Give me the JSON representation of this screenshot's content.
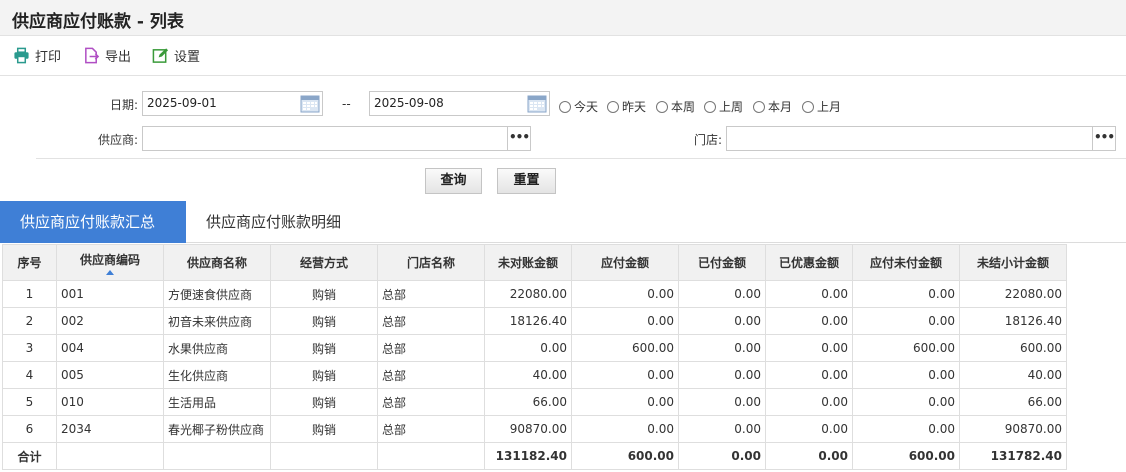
{
  "page": {
    "title": "供应商应付账款 - 列表"
  },
  "toolbar": {
    "print_label": "打印",
    "export_label": "导出",
    "settings_label": "设置"
  },
  "filter": {
    "date_label": "日期:",
    "date_from": "2025-09-01",
    "date_sep": "--",
    "date_to": "2025-09-08",
    "quick_dates": [
      "今天",
      "昨天",
      "本周",
      "上周",
      "本月",
      "上月"
    ],
    "supplier_label": "供应商:",
    "supplier_value": "",
    "store_label": "门店:",
    "store_value": "",
    "more_label": "•••",
    "query_label": "查询",
    "reset_label": "重置"
  },
  "tabs": [
    {
      "label": "供应商应付账款汇总",
      "active": true
    },
    {
      "label": "供应商应付账款明细",
      "active": false
    }
  ],
  "grid": {
    "columns": [
      "序号",
      "供应商编码",
      "供应商名称",
      "经营方式",
      "门店名称",
      "未对账金额",
      "应付金额",
      "已付金额",
      "已优惠金额",
      "应付未付金额",
      "未结小计金额"
    ],
    "rows": [
      [
        "1",
        "001",
        "方便速食供应商",
        "购销",
        "总部",
        "22080.00",
        "0.00",
        "0.00",
        "0.00",
        "0.00",
        "22080.00"
      ],
      [
        "2",
        "002",
        "初音未来供应商",
        "购销",
        "总部",
        "18126.40",
        "0.00",
        "0.00",
        "0.00",
        "0.00",
        "18126.40"
      ],
      [
        "3",
        "004",
        "水果供应商",
        "购销",
        "总部",
        "0.00",
        "600.00",
        "0.00",
        "0.00",
        "600.00",
        "600.00"
      ],
      [
        "4",
        "005",
        "生化供应商",
        "购销",
        "总部",
        "40.00",
        "0.00",
        "0.00",
        "0.00",
        "0.00",
        "40.00"
      ],
      [
        "5",
        "010",
        "生活用品",
        "购销",
        "总部",
        "66.00",
        "0.00",
        "0.00",
        "0.00",
        "0.00",
        "66.00"
      ],
      [
        "6",
        "2034",
        "春光椰子粉供应商",
        "购销",
        "总部",
        "90870.00",
        "0.00",
        "0.00",
        "0.00",
        "0.00",
        "90870.00"
      ]
    ],
    "total": [
      "合计",
      "",
      "",
      "",
      "",
      "131182.40",
      "600.00",
      "0.00",
      "0.00",
      "600.00",
      "131782.40"
    ]
  },
  "colors": {
    "accent": "#3f7fd6",
    "header_bg": "#f1f1f1"
  }
}
